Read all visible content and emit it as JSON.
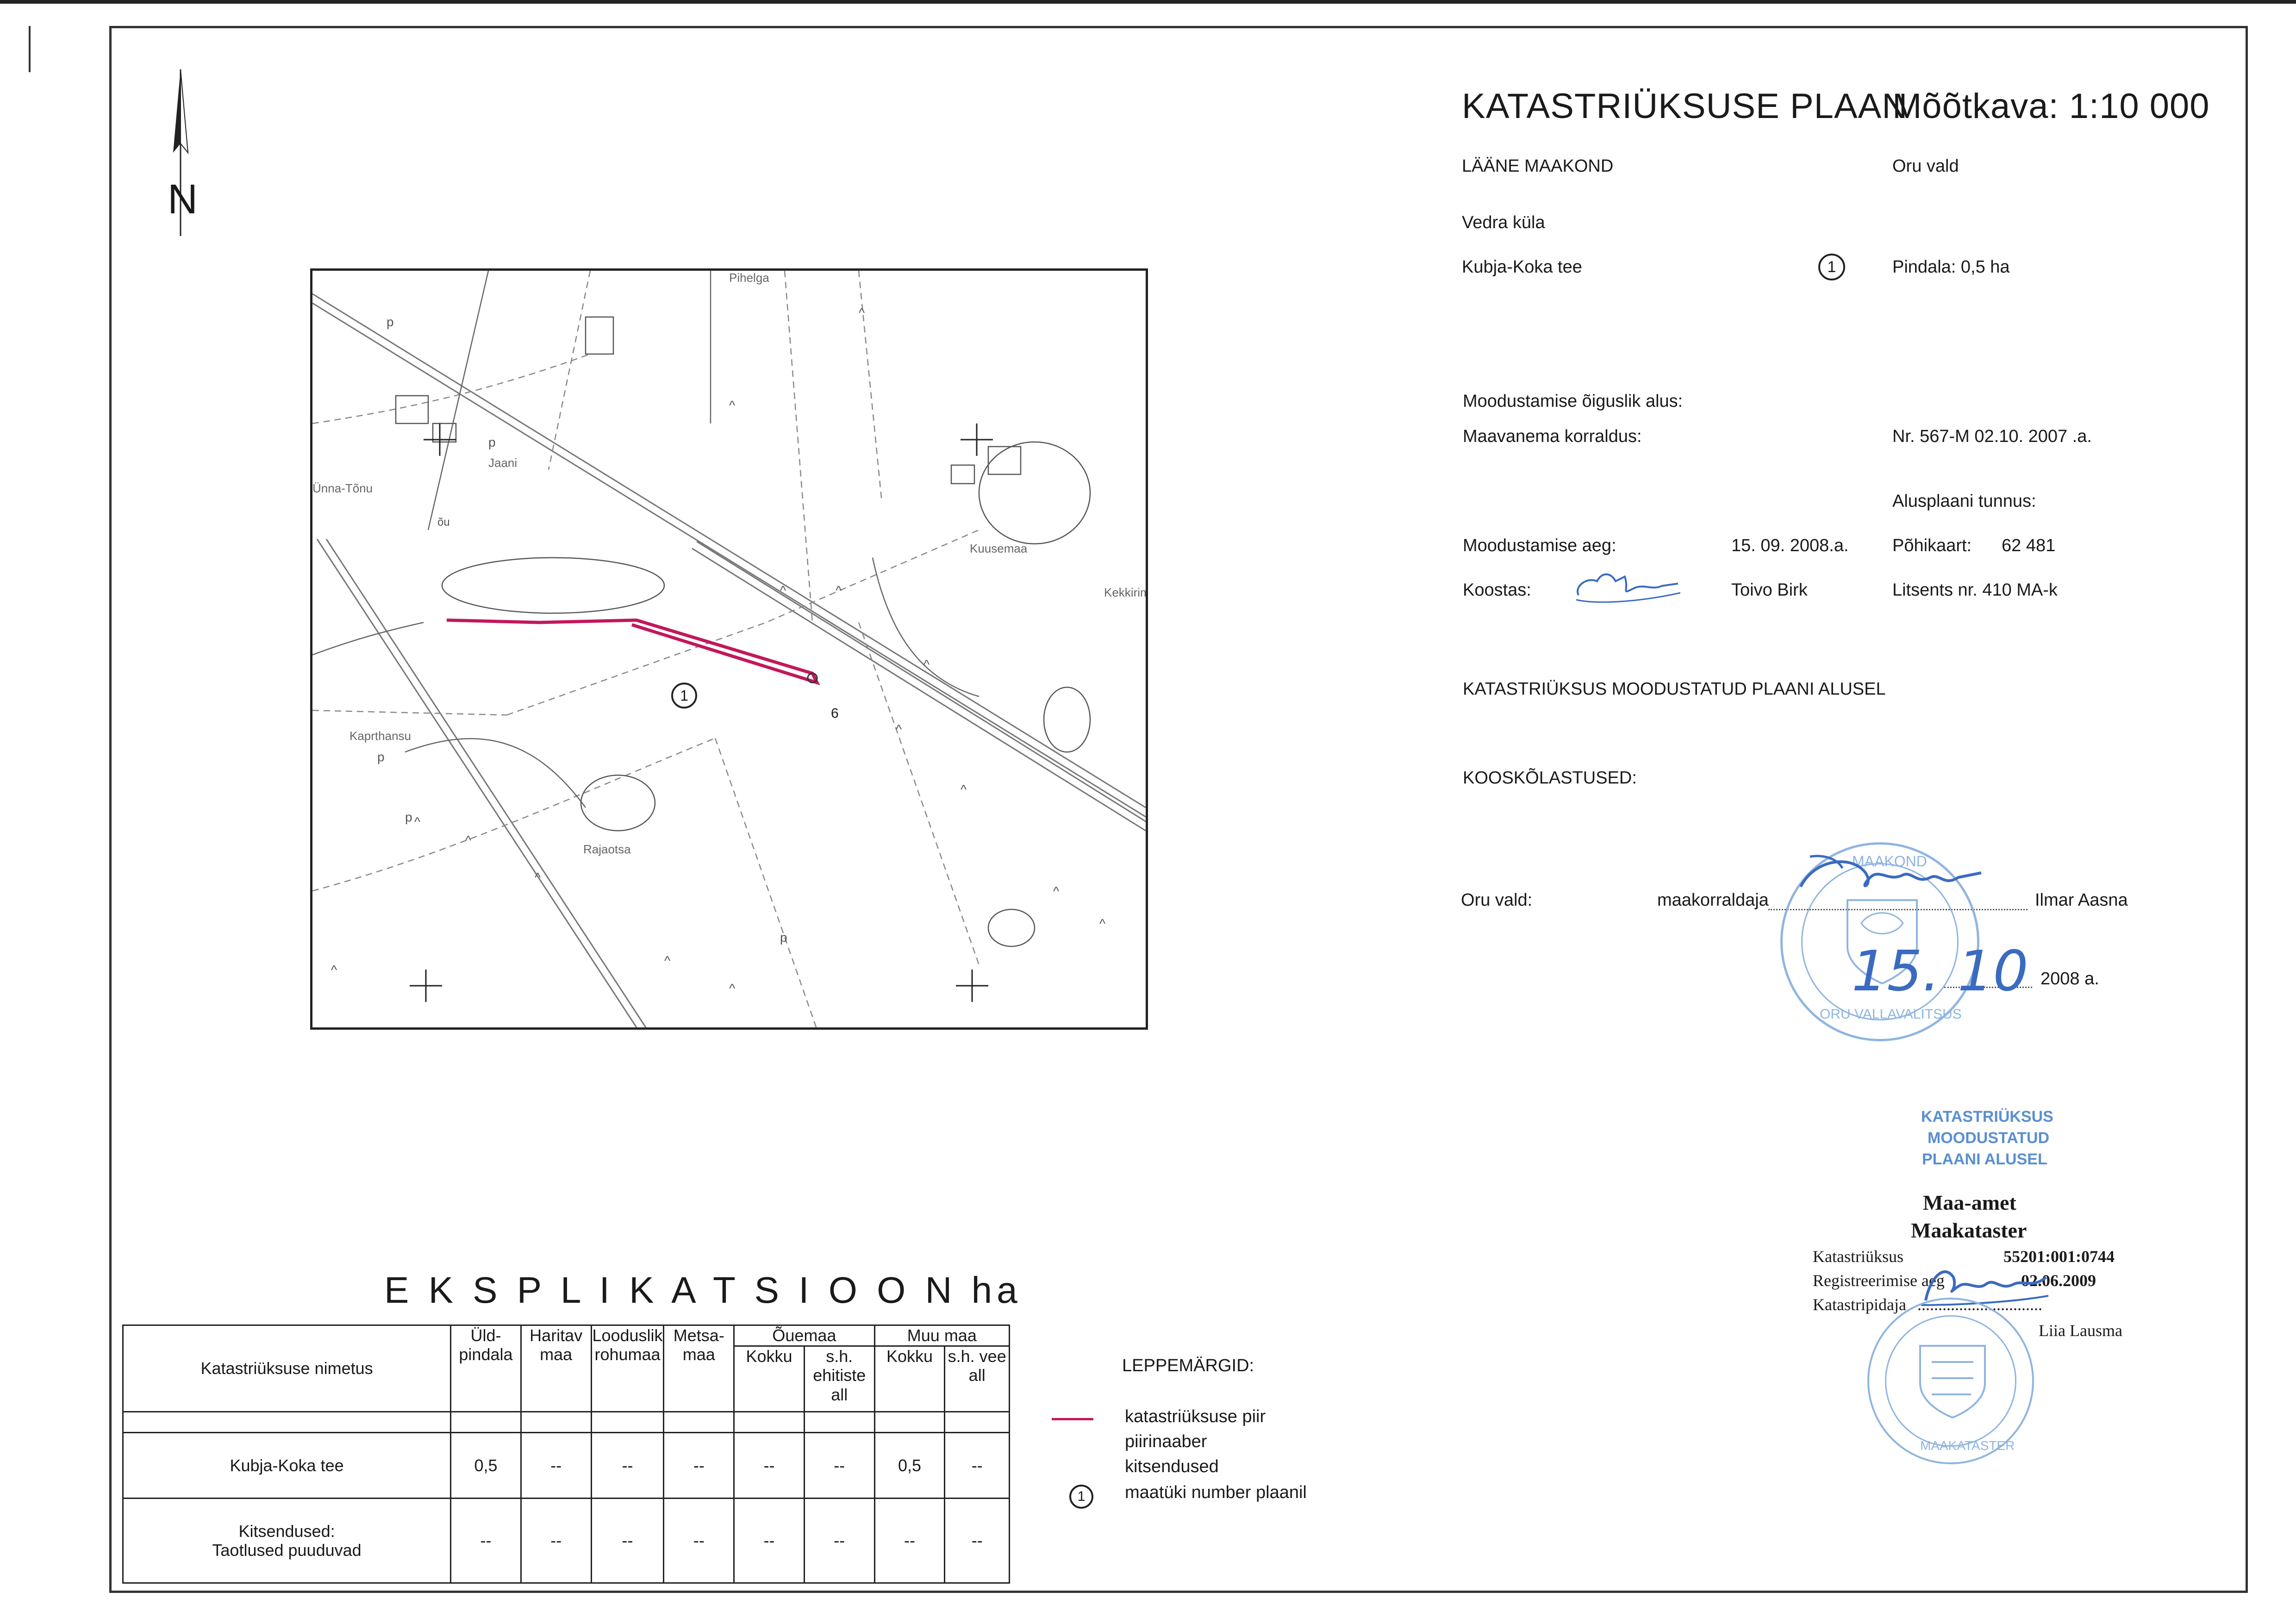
{
  "header": {
    "title": "KATASTRIÜKSUSE PLAAN",
    "scale": "Mõõtkava:  1:10 000",
    "county": "LÄÄNE MAAKOND",
    "parish": "Oru vald",
    "village": "Vedra küla",
    "parcel_name": "Kubja-Koka tee",
    "parcel_number": "1",
    "area": "Pindala:  0,5 ha"
  },
  "basis": {
    "legal_basis_label": "Moodustamise õiguslik alus:",
    "order_label": "Maavanema korraldus:",
    "order_value": "Nr. 567-M    02.10. 2007 .a.",
    "base_map_label": "Alusplaani tunnus:",
    "formed_date_label": "Moodustamise aeg:",
    "formed_date_value": "15. 09. 2008.a.",
    "base_map_key": "Põhikaart:",
    "base_map_value": "62 481",
    "compiled_label": "Koostas:",
    "compiler_name": "Toivo Birk",
    "license": "Litsents nr. 410 MA-k",
    "formed_on_plan": "KATASTRIÜKSUS MOODUSTATUD PLAANI ALUSEL",
    "approvals_label": "KOOSKÕLASTUSED:",
    "approval_party": "Oru vald:",
    "approval_role": "maakorraldaja",
    "approval_person": "Ilmar Aasna",
    "approval_year": "2008  a."
  },
  "stamp_oru": {
    "top_text": "MAAKOND",
    "bottom_text": "ORU VALLAVALITSUS",
    "handwritten_date": "15. 10"
  },
  "registration": {
    "stamp_line1": "KATASTRIÜKSUS",
    "stamp_line2": "MOODUSTATUD",
    "stamp_line3": "PLAANI ALUSEL",
    "office1": "Maa-amet",
    "office2": "Maakataster",
    "parcel_label": "Katastriüksus",
    "parcel_code": "55201:001:0744",
    "reg_time_label": "Registreerimise aeg",
    "reg_date": "02.06.2009",
    "keeper_label": "Katastripidaja",
    "keeper_dots": "..............................",
    "keeper_name": "Liia Lausma",
    "seal_text": "MAAKATASTER"
  },
  "map": {
    "north": "N",
    "place_labels": [
      "Pihelga",
      "Jaani",
      "Ünna-Tõnu",
      "Kuusemaa",
      "Kekkirim",
      "Kaprthansu",
      "Rajaotsa"
    ],
    "parcel_label": "1",
    "point_label": "6",
    "symbol_ou": "õu"
  },
  "legend": {
    "title": "LEPPEMÄRGID:",
    "items": [
      "katastriüksuse piir",
      "piirinaaber",
      "kitsendused",
      "maatüki number plaanil"
    ],
    "parcel_line_color": "#c2185b",
    "circle_num": "1"
  },
  "explication": {
    "title": "E K S P L I K A T S I O O N   ha",
    "col_name": "Katastriüksuse nimetus",
    "col_total": "Üld- pindala",
    "col_arable": "Haritav maa",
    "col_grassland": "Looduslik rohumaa",
    "col_forest": "Metsa- maa",
    "group_yard": "Õuemaa",
    "group_other": "Muu maa",
    "sub_total": "Kokku",
    "sub_built": "s.h. ehitiste all",
    "sub_water": "s.h. vee all",
    "row1": {
      "name": "Kubja-Koka tee",
      "total": "0,5",
      "arable": "--",
      "grass": "--",
      "forest": "--",
      "yard_total": "--",
      "yard_built": "--",
      "other_total": "0,5",
      "other_water": "--"
    },
    "row2": {
      "name_line1": "Kitsendused:",
      "name_line2": "Taotlused puuduvad",
      "total": "--",
      "arable": "--",
      "grass": "--",
      "forest": "--",
      "yard_total": "--",
      "yard_built": "--",
      "other_total": "--",
      "other_water": "--"
    }
  }
}
